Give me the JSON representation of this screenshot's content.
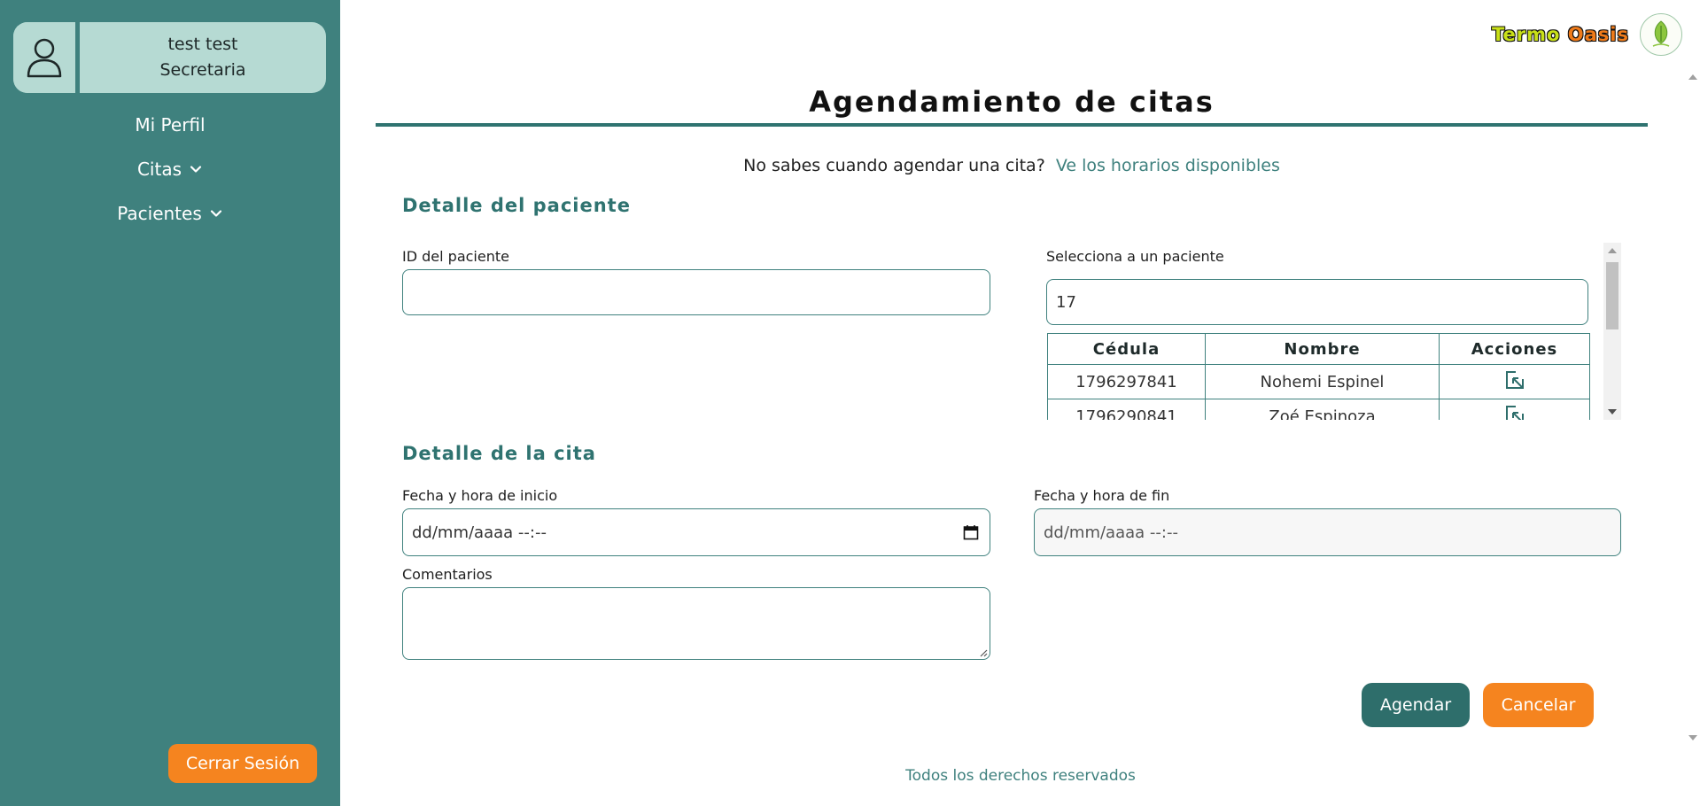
{
  "user": {
    "name": "test test",
    "role": "Secretaria"
  },
  "sidebar": {
    "items": [
      {
        "label": "Mi Perfil"
      },
      {
        "label": "Citas"
      },
      {
        "label": "Pacientes"
      }
    ],
    "logout_label": "Cerrar Sesión"
  },
  "brand": {
    "word1": "Termo",
    "word2": "Oasis"
  },
  "page": {
    "title": "Agendamiento de citas",
    "hint_text": "No sabes cuando agendar una cita?",
    "hint_link": "Ve los horarios disponibles"
  },
  "patient_section": {
    "title": "Detalle del paciente",
    "id_label": "ID del paciente",
    "id_value": "",
    "select_label": "Selecciona a un paciente",
    "search_value": "17",
    "table": {
      "headers": [
        "Cédula",
        "Nombre",
        "Acciones"
      ],
      "rows": [
        {
          "cedula": "1796297841",
          "nombre": "Nohemi Espinel"
        },
        {
          "cedula": "1796290841",
          "nombre": "Zoé Espinoza"
        }
      ]
    }
  },
  "appointment_section": {
    "title": "Detalle de la cita",
    "start_label": "Fecha y hora de inicio",
    "start_placeholder": "dd/mm/aaaa --:--",
    "end_label": "Fecha y hora de fin",
    "end_placeholder": "dd/mm/aaaa --:--",
    "comments_label": "Comentarios",
    "comments_value": ""
  },
  "actions": {
    "submit_label": "Agendar",
    "cancel_label": "Cancelar"
  },
  "footer": {
    "text": "Todos los derechos reservados"
  },
  "colors": {
    "teal": "#3f817e",
    "teal_dark": "#2e6e6b",
    "orange": "#f5841f",
    "mint": "#b6dad3"
  }
}
